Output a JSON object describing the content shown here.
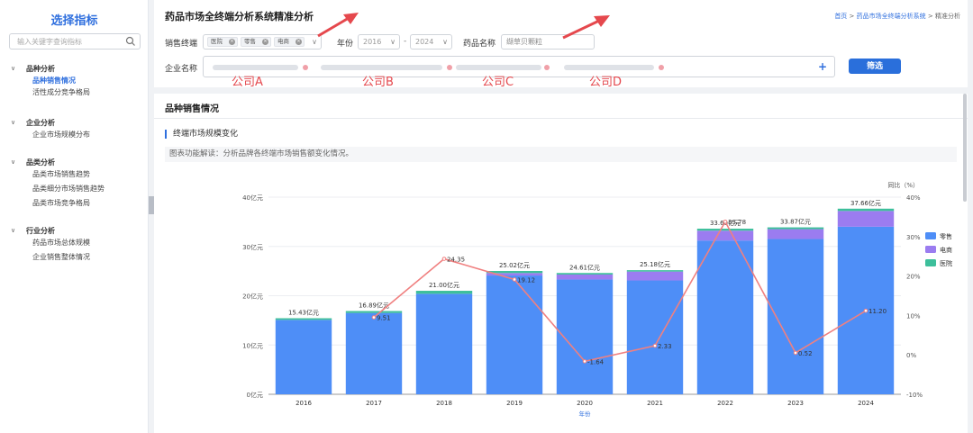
{
  "sidebar": {
    "title": "选择指标",
    "search_placeholder": "输入关键字查询指标",
    "groups": [
      {
        "label": "品种分析",
        "items": [
          "品种销售情况",
          "活性成分竞争格局"
        ]
      },
      {
        "label": "企业分析",
        "items": [
          "企业市场规模分布"
        ]
      },
      {
        "label": "品类分析",
        "items": [
          "品类市场销售趋势",
          "品类细分市场销售趋势",
          "品类市场竞争格局"
        ]
      },
      {
        "label": "行业分析",
        "items": [
          "药品市场总体规模",
          "企业销售整体情况"
        ]
      }
    ]
  },
  "header": {
    "title": "药品市场全终端分析系统精准分析",
    "breadcrumb": {
      "home": "首页",
      "sep1": ">",
      "system": "药品市场全终端分析系统",
      "sep2": ">",
      "current": "精准分析"
    }
  },
  "filters": {
    "terminal_label": "销售终端",
    "terminal_tags": [
      "医院",
      "零售",
      "电商"
    ],
    "year_label": "年份",
    "year_from": "2016",
    "year_sep": "-",
    "year_to": "2024",
    "drug_label": "药品名称",
    "drug_value": "缬草贝颗粒",
    "enterprise_label": "企业名称",
    "company_labels": [
      "公司A",
      "公司B",
      "公司C",
      "公司D"
    ],
    "filter_button": "筛选",
    "plus": "+"
  },
  "main": {
    "panel_title": "品种销售情况",
    "section_title": "终端市场规模变化",
    "note": "图表功能解读：分析品牌各终端市场销售额变化情况。"
  },
  "colors": {
    "retail": "#4e8ef7",
    "ecommerce": "#9b7cf0",
    "hospital": "#3dbf9b",
    "line": "#f08080",
    "accent": "#2a6fdb",
    "annotation": "#e5484d"
  },
  "chart_data": {
    "type": "bar",
    "stacked": true,
    "categories": [
      "2016",
      "2017",
      "2018",
      "2019",
      "2020",
      "2021",
      "2022",
      "2023",
      "2024"
    ],
    "series": [
      {
        "name": "零售",
        "values": [
          15.1,
          16.5,
          20.4,
          24.1,
          23.3,
          23.1,
          31.2,
          31.5,
          34.0
        ]
      },
      {
        "name": "电商",
        "values": [
          0.0,
          0.0,
          0.0,
          0.5,
          1.0,
          1.8,
          2.0,
          2.0,
          3.2
        ]
      },
      {
        "name": "医院",
        "values": [
          0.33,
          0.39,
          0.6,
          0.42,
          0.31,
          0.28,
          0.4,
          0.37,
          0.46
        ]
      }
    ],
    "totals": [
      15.43,
      16.89,
      21.0,
      25.02,
      24.61,
      25.18,
      33.6,
      33.87,
      37.66
    ],
    "total_labels": [
      "15.43亿元",
      "16.89亿元",
      "21.00亿元",
      "25.02亿元",
      "24.61亿元",
      "25.18亿元",
      "33.60亿元",
      "33.87亿元",
      "37.66亿元"
    ],
    "growth": {
      "name": "同比（%）",
      "values": [
        null,
        9.51,
        24.35,
        19.12,
        -1.64,
        2.33,
        33.78,
        0.52,
        11.2
      ],
      "labels": [
        "",
        "9.51",
        "24.35",
        "19.12",
        "-1.64",
        "2.33",
        "33.78",
        "0.52",
        "11.20"
      ]
    },
    "xlabel": "年份",
    "y_ticks": [
      "0亿元",
      "10亿元",
      "20亿元",
      "30亿元",
      "40亿元"
    ],
    "ylim": [
      0,
      40
    ],
    "y2_ticks": [
      "-10%",
      "0%",
      "10%",
      "20%",
      "30%",
      "40%"
    ],
    "y2lim": [
      -10,
      40
    ],
    "y2_label": "同比（%）",
    "legend": [
      "零售",
      "电商",
      "医院"
    ],
    "legend_position": "right",
    "grid": true
  }
}
